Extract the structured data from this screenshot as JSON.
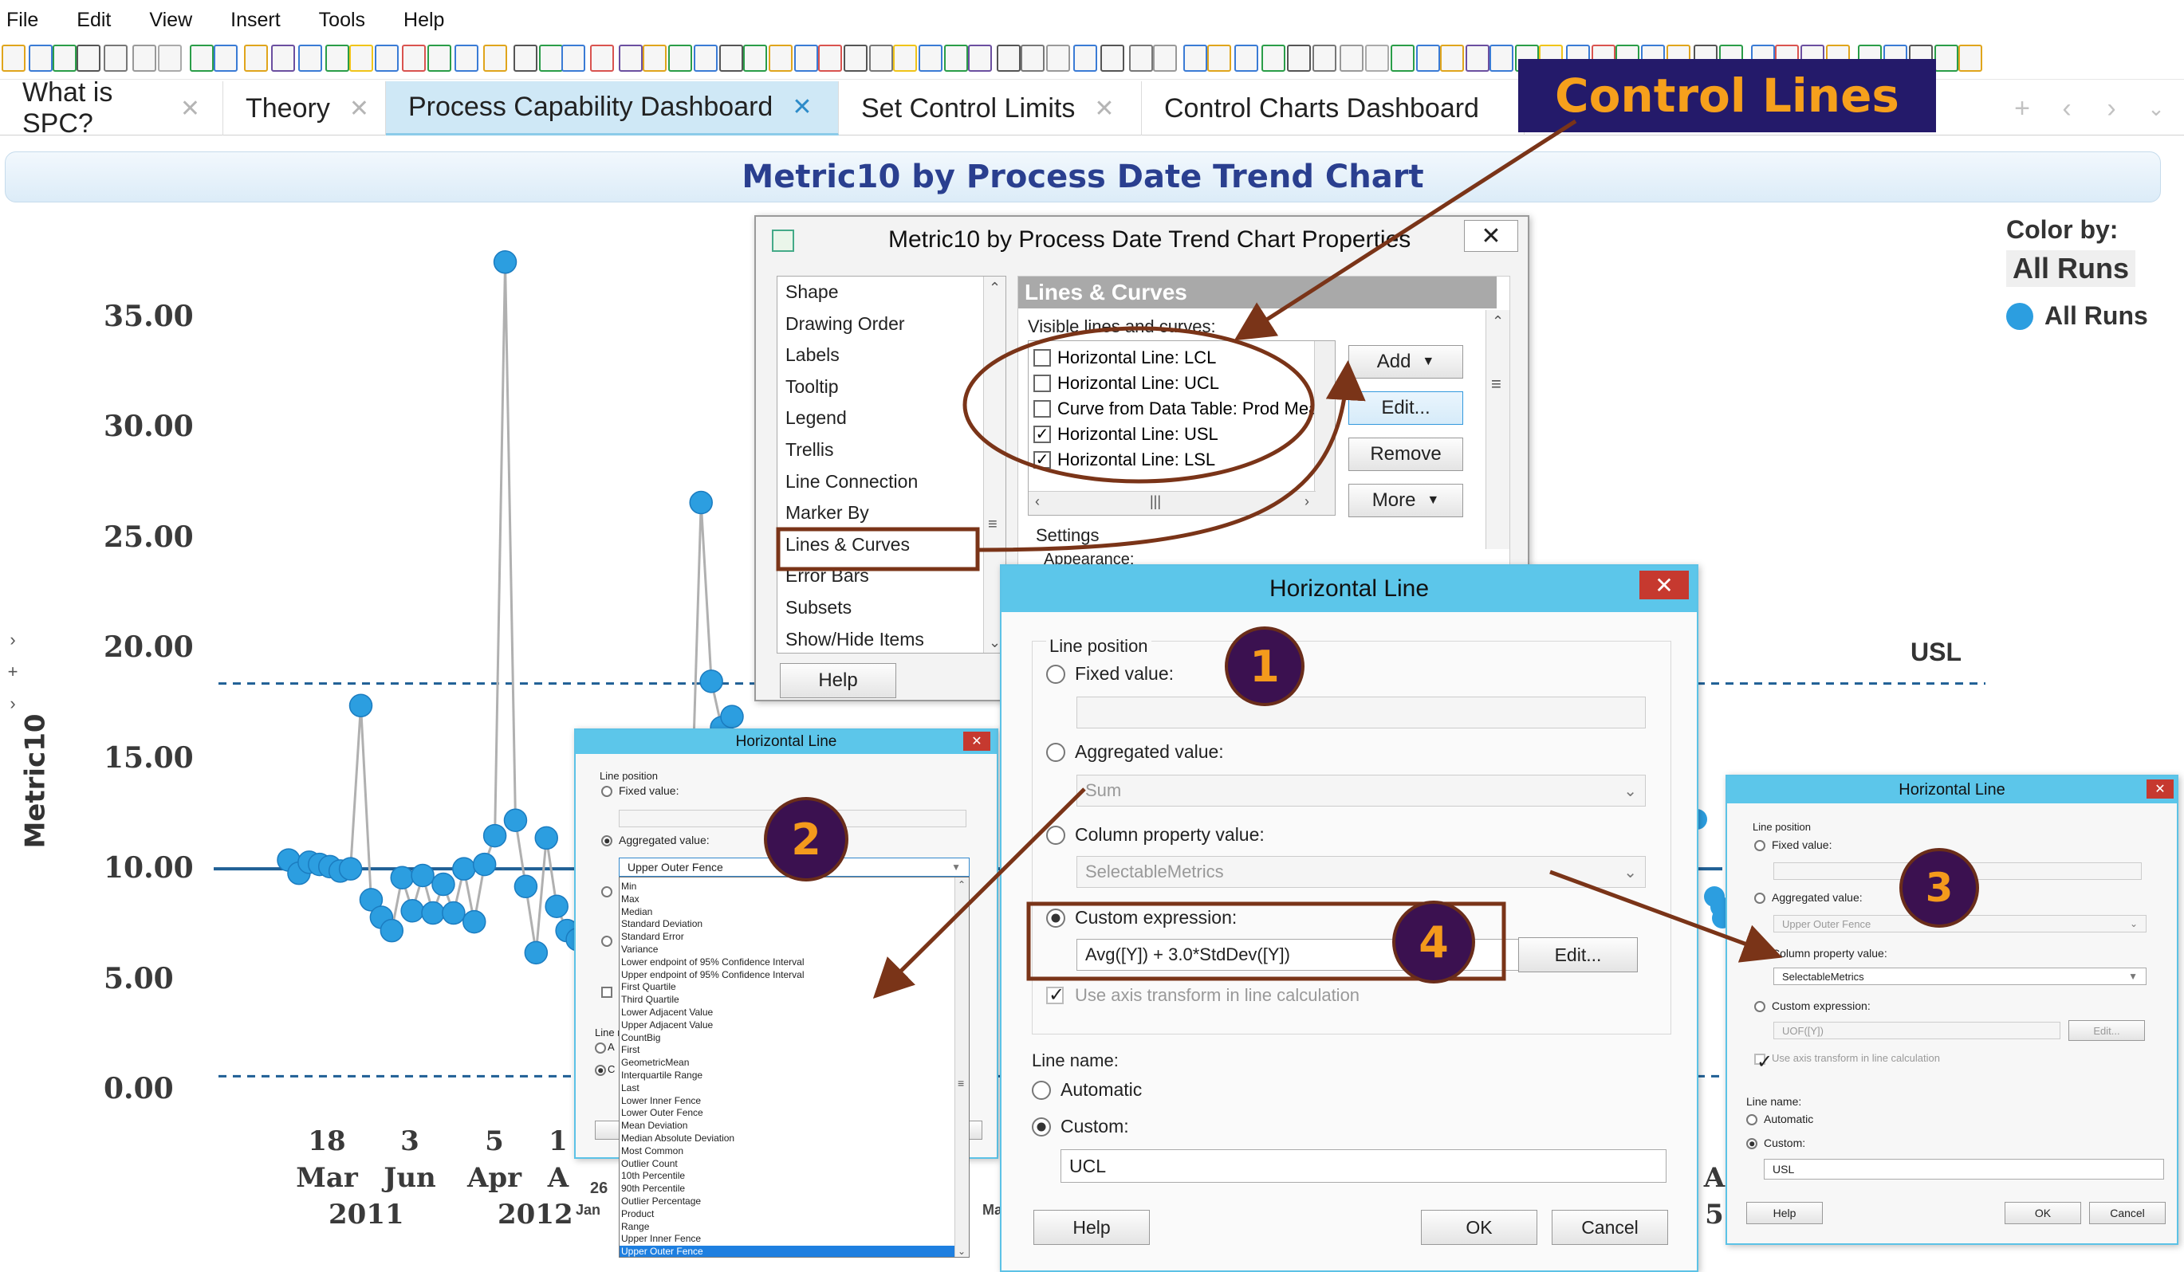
{
  "menu": [
    "File",
    "Edit",
    "View",
    "Insert",
    "Tools",
    "Help"
  ],
  "tabs": [
    {
      "label": "What is SPC?"
    },
    {
      "label": "Theory"
    },
    {
      "label": "Process Capability Dashboard"
    },
    {
      "label": "Set Control Limits"
    },
    {
      "label": "Control Charts Dashboard"
    }
  ],
  "tabs_tail": ")",
  "banner": "Control Lines",
  "chart": {
    "title": "Metric10 by Process Date Trend Chart",
    "ylabel": "Metric10",
    "usl_label": "USL",
    "legend_title": "Color by:",
    "legend_button": "All Runs",
    "legend_item": "All Runs",
    "x_ticks": [
      {
        "day": "18",
        "month": "Mar",
        "year": "2011"
      },
      {
        "day": "3",
        "month": "Jun",
        "year": ""
      },
      {
        "day": "5",
        "month": "Apr",
        "year": "2012"
      },
      {
        "day": "1",
        "month": "A",
        "year": ""
      }
    ],
    "x_tick_right": [
      {
        "day": "",
        "month": "A",
        "year": "5"
      }
    ],
    "colors": {
      "series": "#2c9ee0",
      "ref_line": "#1f5f95",
      "line": "#b0b0b0"
    }
  },
  "chart_data": {
    "type": "line",
    "title": "Metric10 by Process Date Trend Chart",
    "ylabel": "Metric10",
    "ylim": [
      0,
      37
    ],
    "y_ticks": [
      "35.00",
      "30.00",
      "25.00",
      "20.00",
      "15.00",
      "10.00",
      "5.00",
      "0.00"
    ],
    "reference_lines": [
      {
        "name": "USL",
        "value": 18.4
      },
      {
        "name": "",
        "value": 10.0
      },
      {
        "name": "",
        "value": 0.6
      }
    ],
    "series": [
      {
        "name": "All Runs",
        "values": [
          10.4,
          9.8,
          10.3,
          10.2,
          10.1,
          9.9,
          10.0,
          17.4,
          8.6,
          7.8,
          7.2,
          9.6,
          8.1,
          9.7,
          8.0,
          9.3,
          8.0,
          10.0,
          7.6,
          10.2,
          11.5,
          37.5,
          12.2,
          9.2,
          6.2,
          11.4,
          8.3,
          7.2,
          6.8,
          9.5,
          6.7,
          12.0,
          7.8,
          8.4,
          10.4,
          11.2,
          10.2,
          11.0,
          9.0,
          11.4,
          26.6,
          18.5,
          16.4,
          16.9
        ]
      }
    ]
  },
  "props_dialog": {
    "title": "Metric10 by Process Date Trend Chart Properties",
    "nav": [
      "Shape",
      "Drawing Order",
      "Labels",
      "Tooltip",
      "Legend",
      "Trellis",
      "Line Connection",
      "Marker By",
      "Lines & Curves",
      "Error Bars",
      "Subsets",
      "Show/Hide Items"
    ],
    "help": "Help",
    "section": "Lines & Curves",
    "visible_label": "Visible lines and curves:",
    "lines": [
      {
        "label": "Horizontal Line: LCL",
        "checked": false
      },
      {
        "label": "Horizontal Line: UCL",
        "checked": false
      },
      {
        "label": "Curve from Data Table: Prod Mea",
        "checked": false
      },
      {
        "label": "Horizontal Line: USL",
        "checked": true
      },
      {
        "label": "Horizontal Line: LSL",
        "checked": true
      }
    ],
    "add": "Add",
    "edit": "Edit...",
    "remove": "Remove",
    "more": "More",
    "settings": "Settings",
    "appearance": "Appearance:"
  },
  "hl_main": {
    "title": "Horizontal Line",
    "line_position": "Line position",
    "fixed": "Fixed value:",
    "aggregated": "Aggregated value:",
    "aggregated_value": "Sum",
    "colprop": "Column property value:",
    "colprop_value": "SelectableMetrics",
    "custom": "Custom expression:",
    "custom_value": "Avg([Y]) + 3.0*StdDev([Y])",
    "edit": "Edit...",
    "axis_transform": "Use axis transform in line calculation",
    "line_name": "Line name:",
    "automatic": "Automatic",
    "custom_name": "Custom:",
    "name_value": "UCL",
    "help": "Help",
    "ok": "OK",
    "cancel": "Cancel"
  },
  "hl_left": {
    "title": "Horizontal Line",
    "line_position": "Line position",
    "fixed": "Fixed value:",
    "aggregated": "Aggregated value:",
    "selected": "Upper Outer Fence",
    "options": [
      "Min",
      "Max",
      "Median",
      "Standard Deviation",
      "Standard Error",
      "Variance",
      "Lower endpoint of 95% Confidence Interval",
      "Upper endpoint of 95% Confidence Interval",
      "First Quartile",
      "Third Quartile",
      "Lower Adjacent Value",
      "Upper Adjacent Value",
      "CountBig",
      "First",
      "GeometricMean",
      "Interquartile Range",
      "Last",
      "Lower Inner Fence",
      "Lower Outer Fence",
      "Mean Deviation",
      "Median Absolute Deviation",
      "Most Common",
      "Outlier Count",
      "10th Percentile",
      "90th Percentile",
      "Outlier Percentage",
      "Product",
      "Range",
      "Upper Inner Fence",
      "Upper Outer Fence"
    ],
    "line_frag": "Line r",
    "a_frag": "A",
    "c_frag": "C",
    "date_26": "26",
    "date_jan": "Jan",
    "date_ma": "Ma"
  },
  "hl_right": {
    "title": "Horizontal Line",
    "line_position": "Line position",
    "fixed": "Fixed value:",
    "aggregated": "Aggregated value:",
    "aggregated_value": "Upper Outer Fence",
    "colprop": "Column property value:",
    "colprop_value": "SelectableMetrics",
    "custom": "Custom expression:",
    "custom_value": "UOF([Y])",
    "edit": "Edit...",
    "axis_transform": "Use axis transform in line calculation",
    "line_name": "Line name:",
    "automatic": "Automatic",
    "custom_name": "Custom:",
    "name_value": "USL",
    "help": "Help",
    "ok": "OK",
    "cancel": "Cancel"
  },
  "badges": [
    "1",
    "2",
    "3",
    "4"
  ]
}
